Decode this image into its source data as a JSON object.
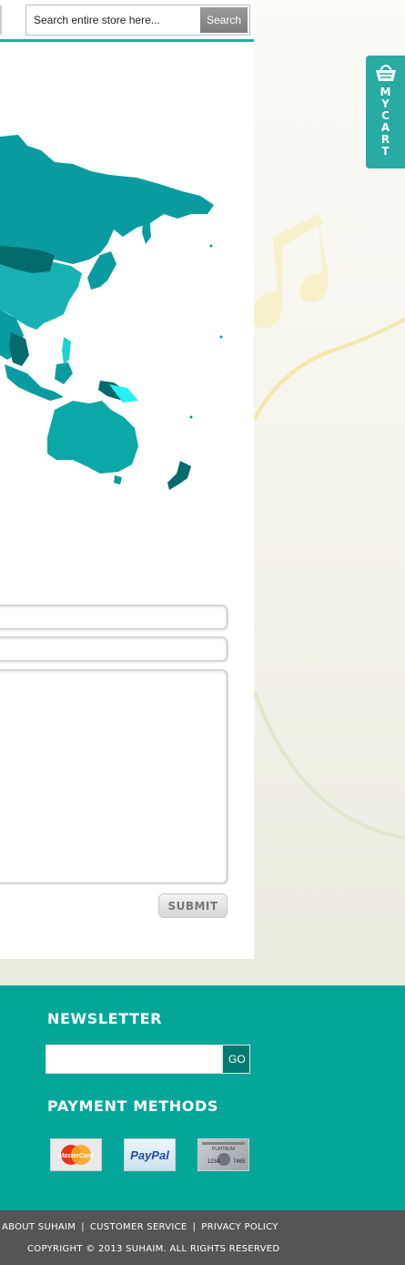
{
  "search": {
    "placeholder": "Search entire store here...",
    "button_label": "Search"
  },
  "cart": {
    "label": "MYCART",
    "icon": "basket-icon"
  },
  "contact_form": {
    "submit_label": "SUBMIT"
  },
  "newsletter": {
    "title": "NEWSLETTER",
    "go_label": "GO"
  },
  "payment": {
    "title": "PAYMENT METHODS",
    "methods": [
      {
        "name": "MasterCard",
        "icon": "mastercard-icon"
      },
      {
        "name": "PayPal",
        "icon": "paypal-icon"
      },
      {
        "name": "PLATINUM",
        "card_digits_left": "1234",
        "card_digits_right": "7465",
        "icon": "platinum-card-icon"
      }
    ]
  },
  "footer": {
    "links": [
      "ABOUT SUHAIM",
      "CUSTOMER SERVICE",
      "PRIVACY POLICY"
    ],
    "separator": "|",
    "copyright": "COPYRIGHT © 2013 SUHAIM. ALL RIGHTS RESERVED"
  },
  "colors": {
    "accent": "#27aba3",
    "footer_bg": "#03a699",
    "bottom_bar": "#555555",
    "map_teal": "#0aa8a6",
    "map_dark": "#036a6e"
  }
}
